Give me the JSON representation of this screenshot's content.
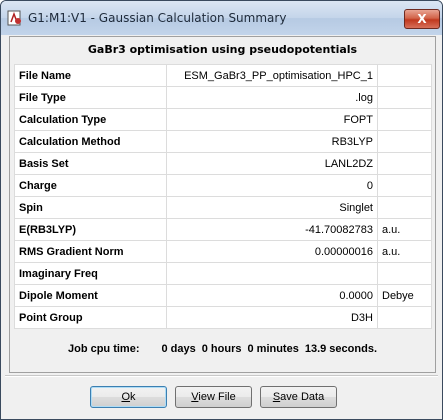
{
  "window": {
    "title": "G1:M1:V1 - Gaussian Calculation Summary",
    "close_label": "X"
  },
  "summary": {
    "title": "GaBr3 optimisation using pseudopotentials",
    "rows": [
      {
        "label": "File Name",
        "value": "ESM_GaBr3_PP_optimisation_HPC_1",
        "unit": ""
      },
      {
        "label": "File Type",
        "value": ".log",
        "unit": ""
      },
      {
        "label": "Calculation Type",
        "value": "FOPT",
        "unit": ""
      },
      {
        "label": "Calculation Method",
        "value": "RB3LYP",
        "unit": ""
      },
      {
        "label": "Basis Set",
        "value": "LANL2DZ",
        "unit": ""
      },
      {
        "label": "Charge",
        "value": "0",
        "unit": ""
      },
      {
        "label": "Spin",
        "value": "Singlet",
        "unit": ""
      },
      {
        "label": "E(RB3LYP)",
        "value": "-41.70082783",
        "unit": "a.u."
      },
      {
        "label": "RMS Gradient Norm",
        "value": "0.00000016",
        "unit": "a.u."
      },
      {
        "label": "Imaginary Freq",
        "value": "",
        "unit": ""
      },
      {
        "label": "Dipole Moment",
        "value": "0.0000",
        "unit": "Debye"
      },
      {
        "label": "Point Group",
        "value": "D3H",
        "unit": ""
      }
    ],
    "job_cpu": {
      "label": "Job cpu time:",
      "days": "0 days",
      "hours": "0 hours",
      "minutes": "0 minutes",
      "seconds": "13.9 seconds."
    }
  },
  "buttons": {
    "ok": {
      "mnemonic": "O",
      "rest": "k"
    },
    "view_file": {
      "mnemonic": "V",
      "rest": "iew File"
    },
    "save_data": {
      "mnemonic": "S",
      "rest": "ave Data"
    }
  },
  "icons": {
    "app_icon": "gaussian-app-icon",
    "close": "close-icon"
  }
}
